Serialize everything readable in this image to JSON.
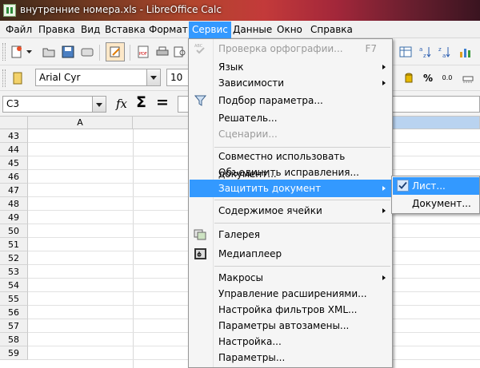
{
  "window": {
    "title": "внутренние номера.xls - LibreOffice Calc"
  },
  "menubar": {
    "items": [
      "Файл",
      "Правка",
      "Вид",
      "Вставка",
      "Формат",
      "Сервис",
      "Данные",
      "Окно",
      "Справка"
    ],
    "active": "Сервис"
  },
  "toolbar": {
    "font_name": "Arial Cyr",
    "font_size": "10",
    "percent_label": "%",
    "decimal_label": "0.0"
  },
  "formula_bar": {
    "cell_ref": "C3",
    "fx_label": "fx",
    "sum_label": "Σ",
    "equals_label": "="
  },
  "grid": {
    "column_headers": [
      "A"
    ],
    "row_numbers": [
      "43",
      "44",
      "45",
      "46",
      "47",
      "48",
      "49",
      "50",
      "51",
      "52",
      "53",
      "54",
      "55",
      "56",
      "57",
      "58",
      "59"
    ]
  },
  "tools_menu": {
    "items": [
      {
        "label": "Проверка орфографии...",
        "shortcut": "F7",
        "disabled": true,
        "icon": "spellcheck-icon"
      },
      {
        "label": "Язык",
        "submenu": true
      },
      {
        "label": "Зависимости",
        "submenu": true
      },
      {
        "label": "Подбор параметра...",
        "icon": "goal-seek-icon"
      },
      {
        "label": "Решатель..."
      },
      {
        "label": "Сценарии...",
        "disabled": true
      },
      {
        "label": "Совместно использовать документ..."
      },
      {
        "label": "Объединить исправления..."
      },
      {
        "label": "Защитить документ",
        "submenu": true,
        "highlighted": true
      },
      {
        "label": "Содержимое ячейки",
        "submenu": true
      },
      {
        "label": "Галерея",
        "icon": "gallery-icon"
      },
      {
        "label": "Медиаплеер",
        "icon": "media-player-icon"
      },
      {
        "label": "Макросы",
        "submenu": true
      },
      {
        "label": "Управление расширениями..."
      },
      {
        "label": "Настройка фильтров XML..."
      },
      {
        "label": "Параметры автозамены..."
      },
      {
        "label": "Настройка..."
      },
      {
        "label": "Параметры..."
      }
    ]
  },
  "protect_submenu": {
    "items": [
      {
        "label": "Лист...",
        "checked": true,
        "highlighted": true
      },
      {
        "label": "Документ..."
      }
    ]
  },
  "colors": {
    "highlight": "#3399ff",
    "menu_bg": "#f5f5f5"
  }
}
